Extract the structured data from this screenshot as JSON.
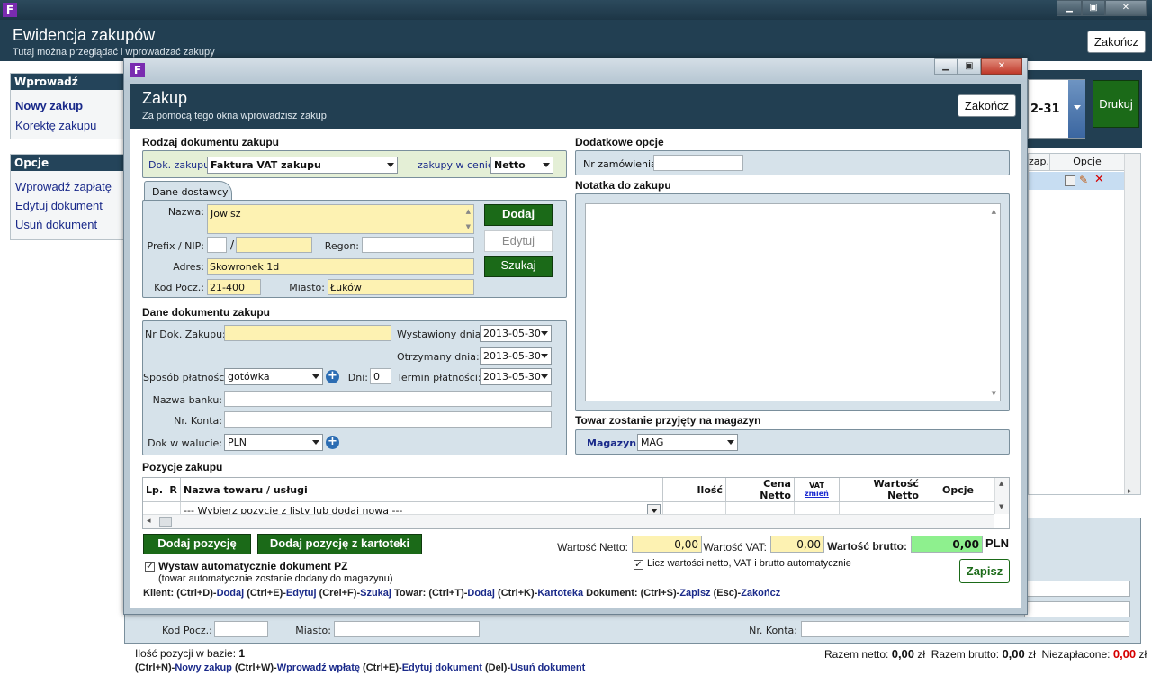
{
  "main": {
    "title": "Ewidencja zakupów",
    "subtitle": "Tutaj można przeglądać i wprowadzać zakupy",
    "close_label": "Zakończ",
    "print_label": "Drukuj",
    "date_partial": "2-31",
    "left_panels": [
      {
        "title": "Wprowadź",
        "items": [
          "Nowy zakup",
          "Korektę zakupu"
        ]
      },
      {
        "title": "Opcje",
        "items": [
          "Wprowadź zapłatę",
          "Edytuj dokument",
          "Usuń dokument"
        ]
      }
    ],
    "table_headers": [
      "zap.",
      "Opcje"
    ],
    "bottom_form": {
      "kod_label": "Kod Pocz.:",
      "miasto_label": "Miasto:",
      "nr_konta_label": "Nr. Konta:"
    },
    "status": {
      "count_label": "Ilość pozycji w bazie:",
      "count_value": "1",
      "netto_label": "Razem netto:",
      "netto_value": "0,00",
      "brutto_label": "Razem brutto:",
      "brutto_value": "0,00",
      "unpaid_label": "Niezapłacone:",
      "unpaid_value": "0,00",
      "currency": "zł"
    },
    "shortcuts": [
      {
        "k": "(Ctrl+N)-",
        "a": "Nowy zakup"
      },
      {
        "k": " (Ctrl+W)-",
        "a": "Wprowadź wpłatę"
      },
      {
        "k": " (Ctrl+E)-",
        "a": "Edytuj dokument"
      },
      {
        "k": " (Del)-",
        "a": "Usuń dokument"
      }
    ]
  },
  "dialog": {
    "title": "Zakup",
    "subtitle": "Za pomocą tego okna wprowadzisz zakup",
    "close_label": "Zakończ",
    "rodzaj": {
      "section": "Rodzaj dokumentu zakupu",
      "dok_label": "Dok. zakupu:",
      "dok_value": "Faktura VAT zakupu",
      "cena_label": "zakupy w cenie:",
      "cena_value": "Netto"
    },
    "dostawca": {
      "tab": "Dane dostawcy",
      "nazwa_label": "Nazwa:",
      "nazwa_value": "Jowisz",
      "prefix_label": "Prefix / NIP:",
      "slash": "/",
      "regon_label": "Regon:",
      "adres_label": "Adres:",
      "adres_value": "Skowronek 1d",
      "kod_label": "Kod Pocz.:",
      "kod_value": "21-400",
      "miasto_label": "Miasto:",
      "miasto_value": "Łuków",
      "btn_dodaj": "Dodaj",
      "btn_edytuj": "Edytuj",
      "btn_szukaj": "Szukaj"
    },
    "dokument": {
      "section": "Dane dokumentu zakupu",
      "nr_label": "Nr Dok. Zakupu:",
      "wyst_label": "Wystawiony dnia:",
      "wyst_value": "2013-05-30",
      "otrz_label": "Otrzymany dnia:",
      "otrz_value": "2013-05-30",
      "sposob_label": "Sposób płatności:",
      "sposob_value": "gotówka",
      "dni_label": "Dni:",
      "dni_value": "0",
      "termin_label": "Termin płatności:",
      "termin_value": "2013-05-30",
      "bank_label": "Nazwa banku:",
      "konto_label": "Nr. Konta:",
      "waluta_label": "Dok w walucie:",
      "waluta_value": "PLN"
    },
    "opcje": {
      "section": "Dodatkowe opcje",
      "zam_label": "Nr zamówienia:"
    },
    "notatka": {
      "section": "Notatka do zakupu"
    },
    "magazyn": {
      "section": "Towar zostanie przyjęty na magazyn",
      "label": "Magazyn:",
      "value": "MAG"
    },
    "pozycje": {
      "section": "Pozycje zakupu",
      "headers": [
        "Lp.",
        "R",
        "Nazwa towaru / usługi",
        "Ilość",
        "Cena Netto",
        "VAT",
        "zmień",
        "Wartość Netto",
        "Opcje"
      ],
      "placeholder": "--- Wybierz pozycję z listy lub dodaj nową ---"
    },
    "footer": {
      "btn_dodaj_poz": "Dodaj pozycję",
      "btn_dodaj_kart": "Dodaj pozycję z kartoteki",
      "netto_label": "Wartość Netto:",
      "netto_value": "0,00",
      "vat_label": "Wartość VAT:",
      "vat_value": "0,00",
      "brutto_label": "Wartość brutto:",
      "brutto_value": "0,00",
      "currency": "PLN",
      "pz_label": "Wystaw automatycznie dokument PZ",
      "pz_sub": "(towar automatycznie zostanie dodany do magazynu)",
      "licz_label": "Licz wartości netto, VAT i brutto automatycznie",
      "zapisz": "Zapisz",
      "shortcuts": [
        {
          "k": "Klient: (Ctrl+D)-",
          "a": "Dodaj"
        },
        {
          "k": " (Ctrl+E)-",
          "a": "Edytuj"
        },
        {
          "k": " (Crel+F)-",
          "a": "Szukaj"
        },
        {
          "k": "  Towar: (Ctrl+T)-",
          "a": "Dodaj"
        },
        {
          "k": " (Ctrl+K)-",
          "a": "Kartoteka"
        },
        {
          "k": " Dokument: (Ctrl+S)-",
          "a": "Zapisz"
        },
        {
          "k": " (Esc)-",
          "a": "Zakończ"
        }
      ]
    }
  }
}
